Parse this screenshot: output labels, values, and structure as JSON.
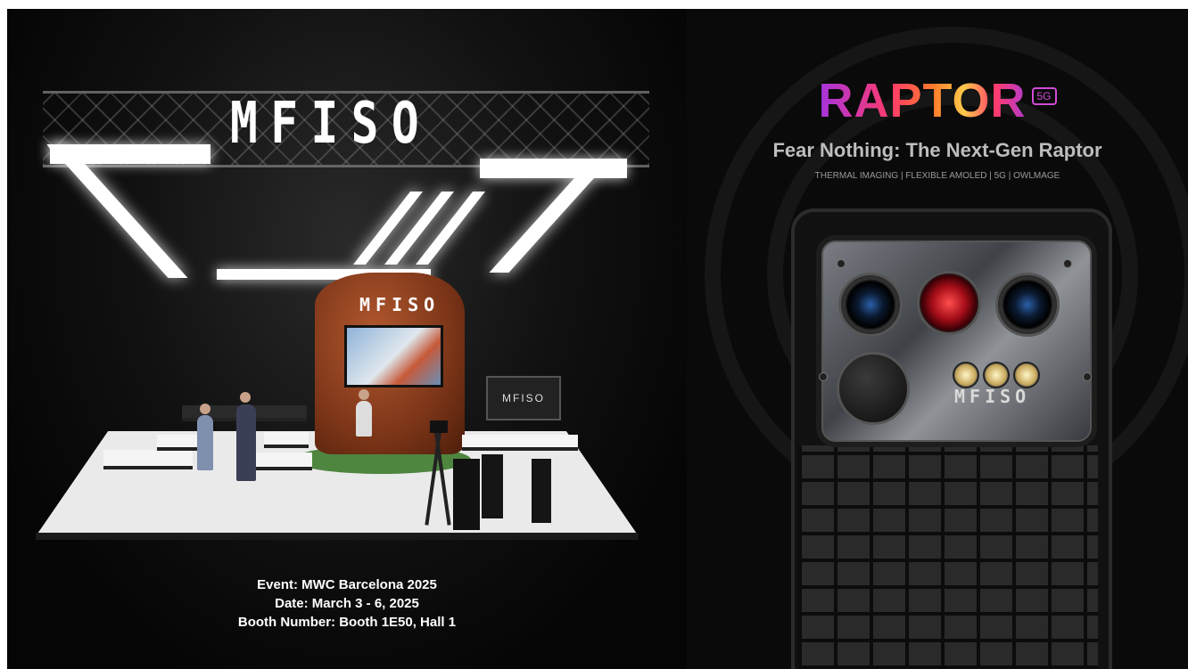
{
  "booth": {
    "ceiling_logo": "MFISO",
    "rock_logo": "MFISO",
    "monitor_logo": "MFISO"
  },
  "event": {
    "event_line": "Event: MWC Barcelona 2025",
    "date_line": "Date: March 3 - 6, 2025",
    "booth_line": "Booth Number: Booth 1E50, Hall 1"
  },
  "product": {
    "name": "RAPTOR",
    "badge": "5G",
    "tagline": "Fear Nothing: The Next-Gen Raptor",
    "features": "THERMAL IMAGING | FLEXIBLE AMOLED | 5G | OWLMAGE",
    "module_logo": "MFISO"
  },
  "colors": {
    "background": "#050505",
    "raptor_gradient": [
      "#a333e0",
      "#ff3b6b",
      "#ff7a2a",
      "#ffc94a"
    ],
    "badge": "#d14bd8"
  }
}
